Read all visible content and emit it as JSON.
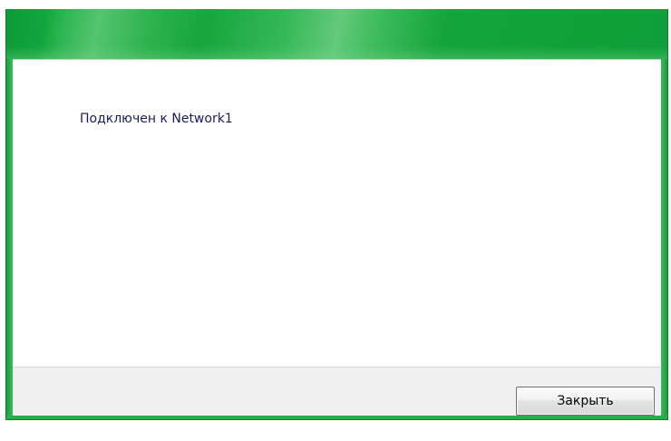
{
  "dialog": {
    "message": "Подключен к Network1",
    "close_label": "Закрыть"
  },
  "colors": {
    "frame_accent": "#15a83a",
    "footer_background": "#f0f0f0",
    "message_text": "#1e1b5c"
  }
}
